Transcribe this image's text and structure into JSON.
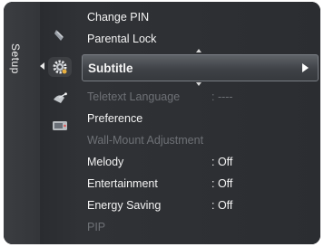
{
  "sidebar": {
    "label": "Setup"
  },
  "icons": [
    {
      "name": "antenna-icon"
    },
    {
      "name": "gear-icon"
    },
    {
      "name": "satellite-dish-icon"
    },
    {
      "name": "input-source-icon"
    }
  ],
  "menu": {
    "items": [
      {
        "label": "Change PIN",
        "value": "",
        "state": "normal"
      },
      {
        "label": "Parental Lock",
        "value": "",
        "state": "normal"
      },
      {
        "label": "Subtitle",
        "value": "",
        "state": "selected"
      },
      {
        "label": "Teletext Language",
        "value": ": ----",
        "state": "disabled"
      },
      {
        "label": "Preference",
        "value": "",
        "state": "normal"
      },
      {
        "label": "Wall-Mount Adjustment",
        "value": "",
        "state": "disabled"
      },
      {
        "label": "Melody",
        "value": ": Off",
        "state": "normal"
      },
      {
        "label": "Entertainment",
        "value": ": Off",
        "state": "normal"
      },
      {
        "label": "Energy Saving",
        "value": ": Off",
        "state": "normal"
      },
      {
        "label": "PIP",
        "value": "",
        "state": "disabled"
      }
    ]
  },
  "colors": {
    "background": "#2e3034",
    "text": "#f4f4f4",
    "disabled_text": "#6e7176",
    "highlight": "#4a4d52"
  }
}
